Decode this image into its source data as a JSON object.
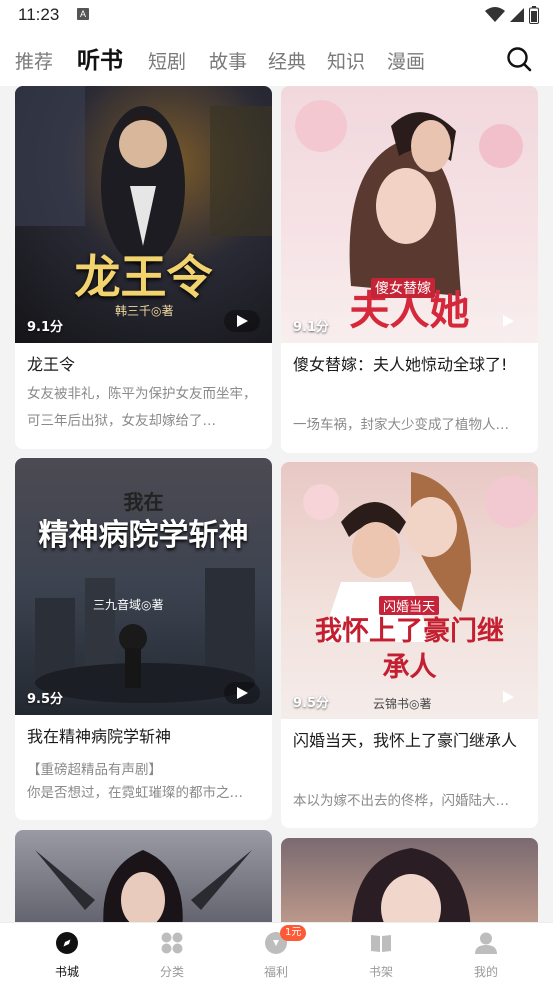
{
  "status": {
    "time": "11:23",
    "a_label": "A"
  },
  "tabs": [
    {
      "label": "推荐"
    },
    {
      "label": "听书"
    },
    {
      "label": "短剧"
    },
    {
      "label": "故事"
    },
    {
      "label": "经典"
    },
    {
      "label": "知识"
    },
    {
      "label": "漫画"
    }
  ],
  "colors": {
    "accent": "#111111",
    "muted": "#9a9a9a",
    "badge": "#ff5a36"
  },
  "cards": [
    {
      "cover_title": "龙王令",
      "cover_author": "韩三千◎著",
      "rating": "9.1分",
      "title": "龙王令",
      "desc": "女友被非礼，陈平为保护女友而坐牢，可三年后出狱，女友却嫁给了…"
    },
    {
      "cover_title": "夫人她",
      "cover_subtitle": "傻女替嫁",
      "rating": "9.1分",
      "title": "傻女替嫁：夫人她惊动全球了!",
      "desc": "一场车祸，封家大少变成了植物人…"
    },
    {
      "cover_title": "精神病院学斩神",
      "cover_subtitle": "我在",
      "cover_author": "三九音域◎著",
      "rating": "9.5分",
      "title": "我在精神病院学斩神",
      "tag": "【重磅超精品有声剧】",
      "desc": "你是否想过，在霓虹璀璨的都市之…"
    },
    {
      "cover_title": "我怀上了豪门继承人",
      "cover_subtitle": "闪婚当天",
      "cover_author": "云锦书◎著",
      "rating": "9.5分",
      "title": "闪婚当天，我怀上了豪门继承人",
      "desc": "本以为嫁不出去的佟桦，闪婚陆大…"
    }
  ],
  "nav": [
    {
      "label": "书城",
      "icon": "compass-icon"
    },
    {
      "label": "分类",
      "icon": "grid-icon"
    },
    {
      "label": "福利",
      "icon": "gift-icon",
      "badge": "1元"
    },
    {
      "label": "书架",
      "icon": "book-icon"
    },
    {
      "label": "我的",
      "icon": "user-icon"
    }
  ]
}
